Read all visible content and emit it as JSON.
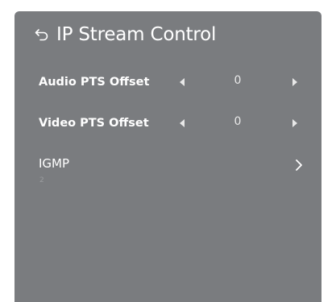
{
  "panel": {
    "title": "IP Stream Control",
    "background": "#7a7c7f"
  },
  "rows": [
    {
      "label": "Audio PTS Offset",
      "value": "0"
    },
    {
      "label": "Video PTS Offset",
      "value": "0"
    }
  ],
  "igmp": {
    "label": "IGMP",
    "sub_value": "2"
  },
  "icons": {
    "back": "back-arrow-icon",
    "left": "arrow-left-icon",
    "right": "arrow-right-icon",
    "chevron": "chevron-right-icon"
  }
}
